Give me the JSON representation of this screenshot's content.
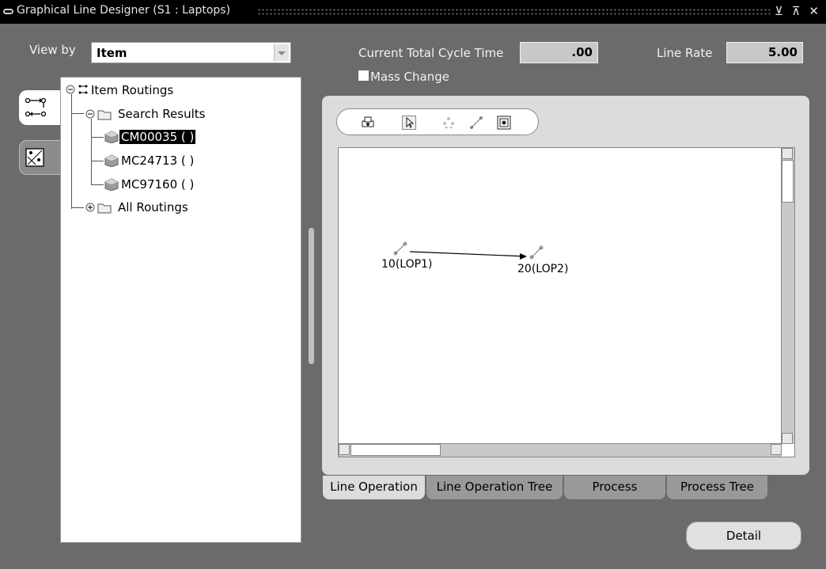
{
  "window": {
    "title": "Graphical Line Designer (S1 : Laptops)",
    "controls": "⊻ ⊼ ✕"
  },
  "header": {
    "view_by_label": "View by",
    "view_by_value": "Item",
    "cycle_time_label": "Current Total Cycle Time",
    "cycle_time_value": ".00",
    "line_rate_label": "Line Rate",
    "line_rate_value": "5.00",
    "mass_change_label": "Mass Change",
    "mass_change_checked": false
  },
  "tree": {
    "root": "Item Routings",
    "search_results": "Search Results",
    "items": [
      "CM00035 ( )",
      "MC24713 ( )",
      "MC97160 ( )"
    ],
    "selected_index": 0,
    "all_routings": "All Routings"
  },
  "canvas": {
    "operations": [
      {
        "label": "10(LOP1)"
      },
      {
        "label": "20(LOP2)"
      }
    ]
  },
  "tabs": [
    {
      "label": "Line Operation",
      "active": true
    },
    {
      "label": "Line Operation Tree",
      "active": false
    },
    {
      "label": "Process",
      "active": false
    },
    {
      "label": "Process Tree",
      "active": false
    }
  ],
  "detail_button": "Detail",
  "icons": [
    "window-icon",
    "routing-tree-icon",
    "diagram-icon",
    "print-icon",
    "pointer-icon",
    "node-icon",
    "connector-icon",
    "zoom-fit-icon"
  ]
}
